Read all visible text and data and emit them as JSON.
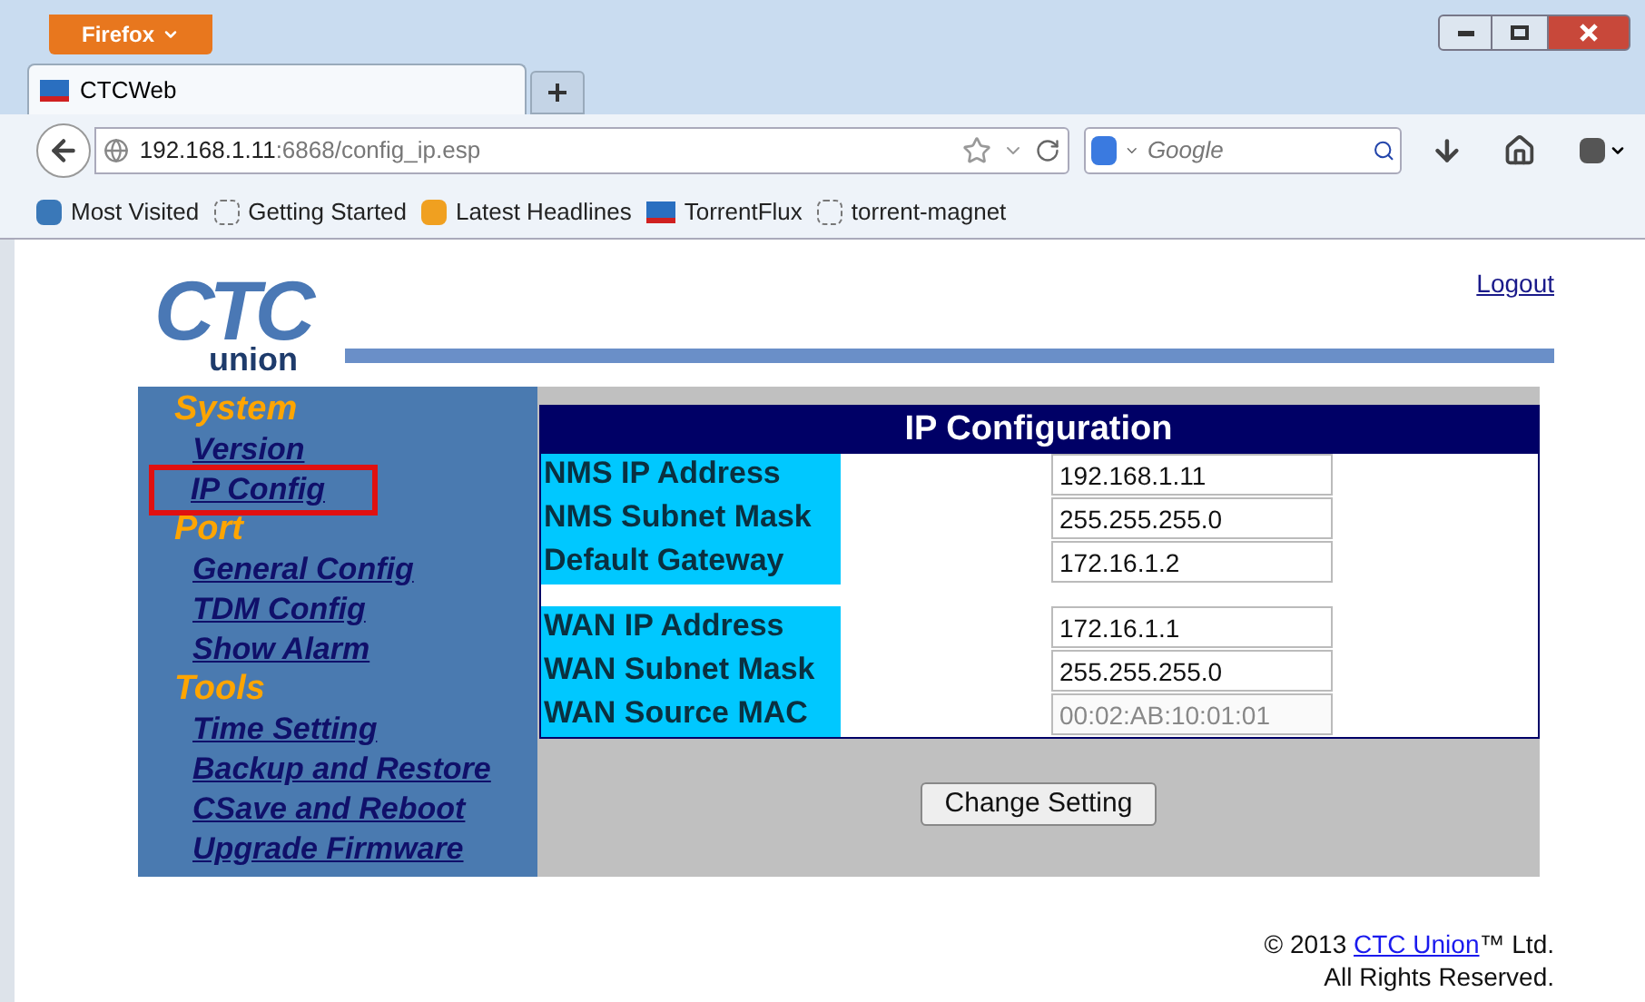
{
  "browser": {
    "menu_button": "Firefox",
    "tabs": [
      {
        "title": "CTCWeb",
        "selected": true
      }
    ],
    "url_host": "192.168.1.11",
    "url_rest": ":6868/config_ip.esp",
    "search_placeholder": "Google",
    "bookmarks": [
      {
        "label": "Most Visited",
        "kind": "search"
      },
      {
        "label": "Getting Started",
        "kind": "blank"
      },
      {
        "label": "Latest Headlines",
        "kind": "feed"
      },
      {
        "label": "TorrentFlux",
        "kind": "logo"
      },
      {
        "label": "torrent-magnet",
        "kind": "blank"
      }
    ]
  },
  "page": {
    "logo_main": "CTC",
    "logo_sub": "union",
    "logout": "Logout",
    "sidebar": [
      {
        "title": "System",
        "items": [
          {
            "label": "Version",
            "highlighted": false
          },
          {
            "label": "IP Config",
            "highlighted": true
          }
        ]
      },
      {
        "title": "Port",
        "items": [
          {
            "label": "General Config",
            "highlighted": false
          },
          {
            "label": "TDM Config",
            "highlighted": false
          },
          {
            "label": "Show Alarm",
            "highlighted": false
          }
        ]
      },
      {
        "title": "Tools",
        "items": [
          {
            "label": "Time Setting",
            "highlighted": false
          },
          {
            "label": "Backup and Restore",
            "highlighted": false
          },
          {
            "label": "CSave and Reboot",
            "highlighted": false
          },
          {
            "label": "Upgrade Firmware",
            "highlighted": false
          }
        ]
      }
    ],
    "form": {
      "title": "IP Configuration",
      "groups": [
        [
          {
            "label": "NMS IP Address",
            "value": "192.168.1.11",
            "disabled": false
          },
          {
            "label": "NMS Subnet Mask",
            "value": "255.255.255.0",
            "disabled": false
          },
          {
            "label": "Default Gateway",
            "value": "172.16.1.2",
            "disabled": false
          }
        ],
        [
          {
            "label": "WAN IP Address",
            "value": "172.16.1.1",
            "disabled": false
          },
          {
            "label": "WAN Subnet Mask",
            "value": "255.255.255.0",
            "disabled": false
          },
          {
            "label": "WAN Source MAC",
            "value": "00:02:AB:10:01:01",
            "disabled": true
          }
        ]
      ],
      "submit": "Change Setting"
    },
    "footer": {
      "copyright": "© 2013",
      "company_link": "CTC Union",
      "suffix": "™ Ltd.",
      "rights": "All Rights Reserved."
    }
  }
}
